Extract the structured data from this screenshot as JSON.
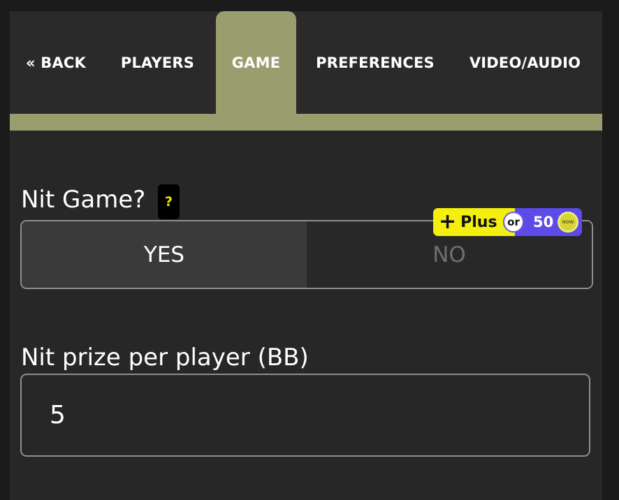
{
  "tabs": {
    "back": "« BACK",
    "players": "PLAYERS",
    "game": "GAME",
    "preferences": "PREFERENCES",
    "video_audio": "VIDEO/AUDIO",
    "active": "GAME"
  },
  "nit_game": {
    "label": "Nit Game?",
    "help": "?",
    "options": [
      "YES",
      "NO"
    ],
    "selected": "YES"
  },
  "plus_badge": {
    "plus_sign": "+",
    "plus_label": "Plus",
    "or_label": "or",
    "coin_amount": "50",
    "coin_text": "NOW"
  },
  "nit_prize": {
    "label": "Nit prize per player (BB)",
    "value": "5"
  },
  "colors": {
    "accent": "#9a9d6e",
    "background": "#272727",
    "help_yellow": "#f3e600",
    "plus_yellow": "#f4ef0d",
    "plus_purple": "#5c4be8"
  }
}
